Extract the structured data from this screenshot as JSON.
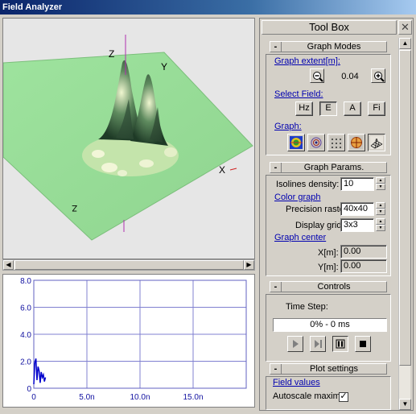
{
  "window": {
    "title": "Field Analyzer"
  },
  "view3d": {
    "axes": {
      "x": "X",
      "y": "Y",
      "z": "Z",
      "w": "Z"
    },
    "surface_color": "#9ddc9d"
  },
  "plot2d": {
    "chart_data": {
      "type": "line",
      "y_ticks": [
        "8.0",
        "6.0",
        "4.0",
        "2.0",
        "0"
      ],
      "x_ticks": [
        "0",
        "5.0n",
        "10.0n",
        "15.0n"
      ],
      "ylim": [
        0,
        8
      ],
      "xlim": [
        0,
        20
      ],
      "grid": true,
      "series": [
        {
          "color": "#0000cc",
          "x": [
            0.0,
            0.1,
            0.2,
            0.3,
            0.4,
            0.5,
            0.6,
            0.7,
            0.8,
            0.9,
            1.0,
            1.1
          ],
          "y": [
            0.3,
            1.9,
            2.2,
            0.6,
            1.6,
            1.3,
            0.4,
            1.2,
            0.8,
            1.0,
            0.5,
            0.8
          ]
        }
      ]
    }
  },
  "toolbox": {
    "title": "Tool Box",
    "close": "✕",
    "graph_modes": {
      "title": "Graph Modes",
      "toggle": "-",
      "extent_label": "Graph extent[m]:",
      "extent_value": "0.04",
      "select_field_label": "Select Field:",
      "fields": [
        "Hz",
        "E",
        "A",
        "Fi"
      ],
      "graph_label": "Graph:"
    },
    "graph_params": {
      "title": "Graph Params.",
      "toggle": "-",
      "isolines_label": "Isolines density:",
      "isolines_value": "10",
      "color_graph_label": "Color graph",
      "precision_label": "Precision raster:",
      "precision_value": "40x40",
      "display_grid_label": "Display grid:",
      "display_grid_value": "3x3",
      "graph_center_label": "Graph center",
      "x_label": "X[m]:",
      "x_value": "0.00",
      "y_label": "Y[m]:",
      "y_value": "0.00"
    },
    "controls": {
      "title": "Controls",
      "toggle": "-",
      "time_step_label": "Time Step:",
      "time_step_value": "0% - 0 ms"
    },
    "plot_settings": {
      "title": "Plot settings",
      "toggle": "-",
      "field_values_label": "Field values",
      "autoscale_label": "Autoscale maximal",
      "autoscale_checked": "✓"
    }
  }
}
